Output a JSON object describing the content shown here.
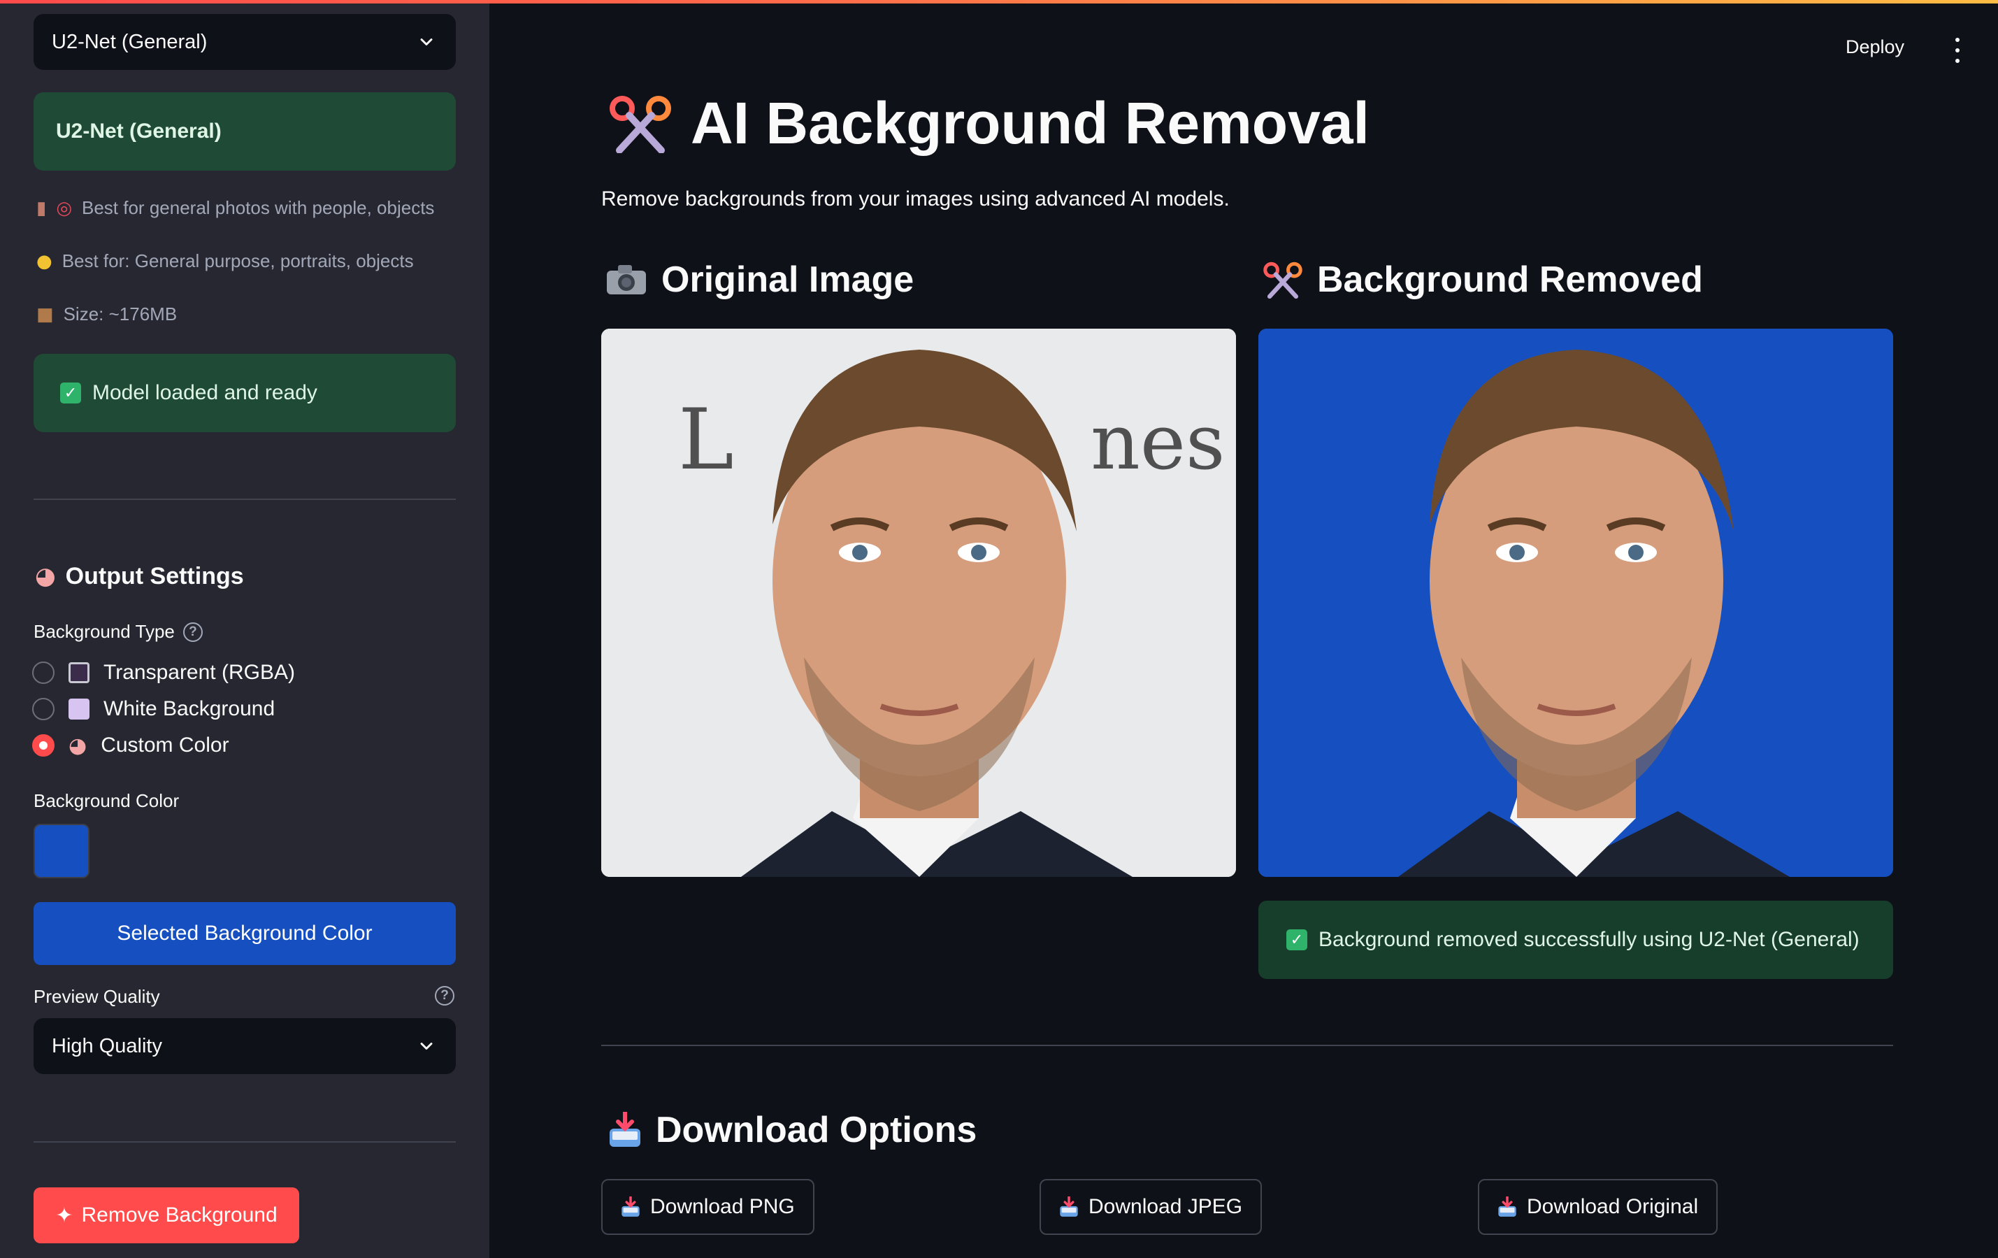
{
  "app": {
    "deploy_label": "Deploy"
  },
  "sidebar": {
    "model_select_value": "U2-Net (General)",
    "model_name": "U2-Net (General)",
    "model_description": "Best for general photos with people, objects",
    "best_for": "Best for: General purpose, portraits, objects",
    "size": "Size: ~176MB",
    "model_status": "Model loaded and ready",
    "output_settings_title": "Output Settings",
    "background_type_label": "Background Type",
    "background_options": [
      {
        "label": "Transparent (RGBA)",
        "selected": false
      },
      {
        "label": "White Background",
        "selected": false
      },
      {
        "label": "Custom Color",
        "selected": true
      }
    ],
    "background_color_label": "Background Color",
    "background_color_value": "#1650c0",
    "selected_color_button": "Selected Background Color",
    "preview_quality_label": "Preview Quality",
    "preview_quality_value": "High Quality",
    "remove_button": "Remove Background"
  },
  "main": {
    "title": "AI Background Removal",
    "subtitle": "Remove backgrounds from your images using advanced AI models.",
    "original_heading": "Original Image",
    "removed_heading": "Background Removed",
    "success_message": "Background removed successfully using U2-Net (General)",
    "download_heading": "Download Options",
    "download_buttons": [
      "Download PNG",
      "Download JPEG",
      "Download Original"
    ]
  },
  "colors": {
    "accent": "#ff4b4b",
    "custom_background": "#1650c0",
    "success_bg": "#173d2b"
  }
}
